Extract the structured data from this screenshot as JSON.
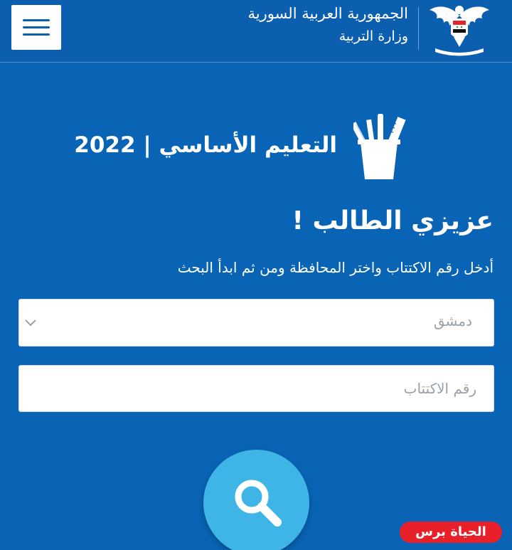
{
  "header": {
    "country_name": "الجمهورية العربية السورية",
    "ministry_name": "وزارة التربية"
  },
  "exam": {
    "title": "التعليم الأساسي | 2022"
  },
  "greeting": {
    "heading": "عزيزي الطالب !",
    "instructions": "أدخل رقم الاكتتاب واختر المحافظة ومن ثم ابدأ البحث"
  },
  "form": {
    "governorate_selected": "دمشق",
    "subscription_placeholder": "رقم الاكتتاب"
  },
  "watermark": {
    "text": "الحياة برس"
  },
  "icons": {
    "menu": "hamburger-menu-icon",
    "emblem": "eagle-emblem-icon",
    "exam": "pencil-cup-icon",
    "select": "chevron-down-icon",
    "search": "search-icon"
  },
  "colors": {
    "background": "#0a64b6",
    "header": "#0b5fae",
    "search_button": "#3fb4e6",
    "watermark": "#e8202a"
  }
}
